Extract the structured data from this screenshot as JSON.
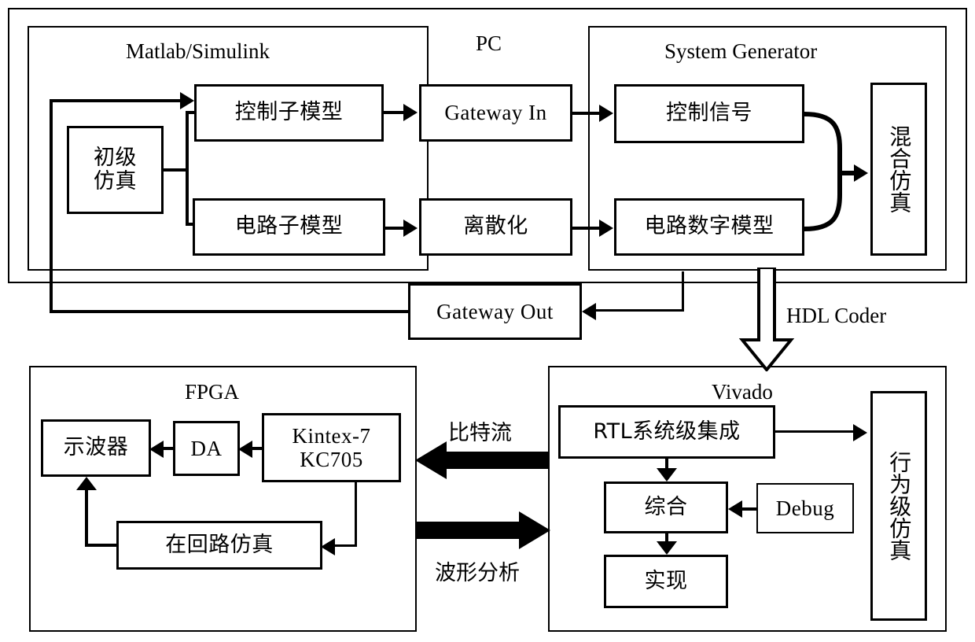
{
  "diagram": {
    "title": "Matlab/Simulink + System Generator + Vivado + FPGA co-simulation flow",
    "frames": {
      "pc": "PC",
      "matlab": "Matlab/Simulink",
      "sysgen": "System Generator",
      "fpga": "FPGA",
      "vivado": "Vivado"
    },
    "nodes": {
      "primary_sim": "初级仿真",
      "control_submodel": "控制子模型",
      "circuit_submodel": "电路子模型",
      "gateway_in": "Gateway In",
      "discretization": "离散化",
      "control_signal": "控制信号",
      "circuit_digital_model": "电路数字模型",
      "hybrid_sim": "混合仿真",
      "gateway_out": "Gateway Out",
      "rtl_integration": "RTL系统级集成",
      "synthesis": "综合",
      "debug": "Debug",
      "implementation": "实现",
      "behavioral_sim": "行为级仿真",
      "oscilloscope": "示波器",
      "da": "DA",
      "kintex_line1": "Kintex-7",
      "kintex_line2": "KC705",
      "hardware_in_loop": "在回路仿真"
    },
    "edge_labels": {
      "hdl_coder": "HDL Coder",
      "bitstream": "比特流",
      "waveform_analysis": "波形分析"
    },
    "colors": {
      "stroke": "#000000",
      "background": "#ffffff"
    }
  }
}
